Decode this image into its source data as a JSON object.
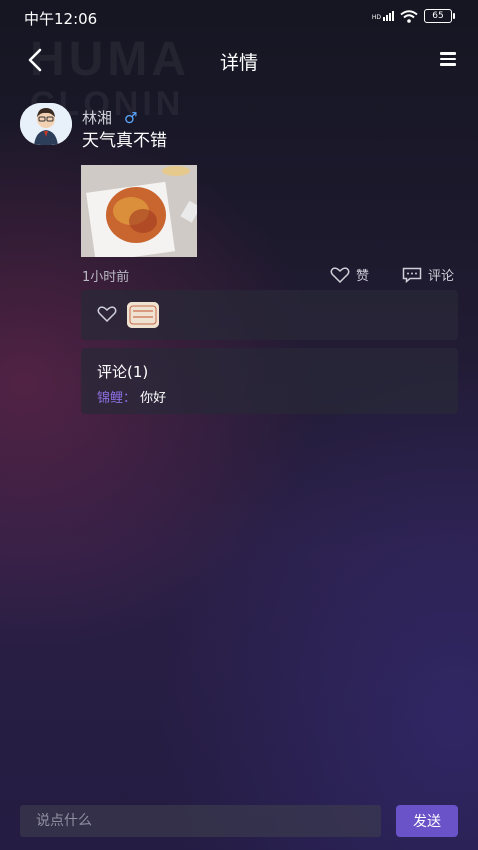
{
  "status_bar": {
    "time": "中午12:06",
    "network": "HD",
    "battery": "65"
  },
  "nav": {
    "title": "详情"
  },
  "post": {
    "username": "林湘",
    "gender_symbol": "♂",
    "text": "天气真不错",
    "time_ago": "1小时前",
    "like_label": "赞",
    "comment_label": "评论"
  },
  "comments": {
    "title": "评论(1)",
    "items": [
      {
        "name": "锦鲤：",
        "content": "你好"
      }
    ]
  },
  "footer": {
    "placeholder": "说点什么",
    "send_label": "发送"
  },
  "watermark": {
    "line1": "HUMA",
    "line2": "CLONIN"
  },
  "colors": {
    "accent": "#6a52c9",
    "comment_name": "#8a6fe0",
    "male": "#5aa8ff"
  },
  "icons": [
    "back-icon",
    "menu-icon",
    "heart-icon",
    "comment-icon",
    "signal-icon",
    "wifi-icon",
    "battery-icon"
  ]
}
